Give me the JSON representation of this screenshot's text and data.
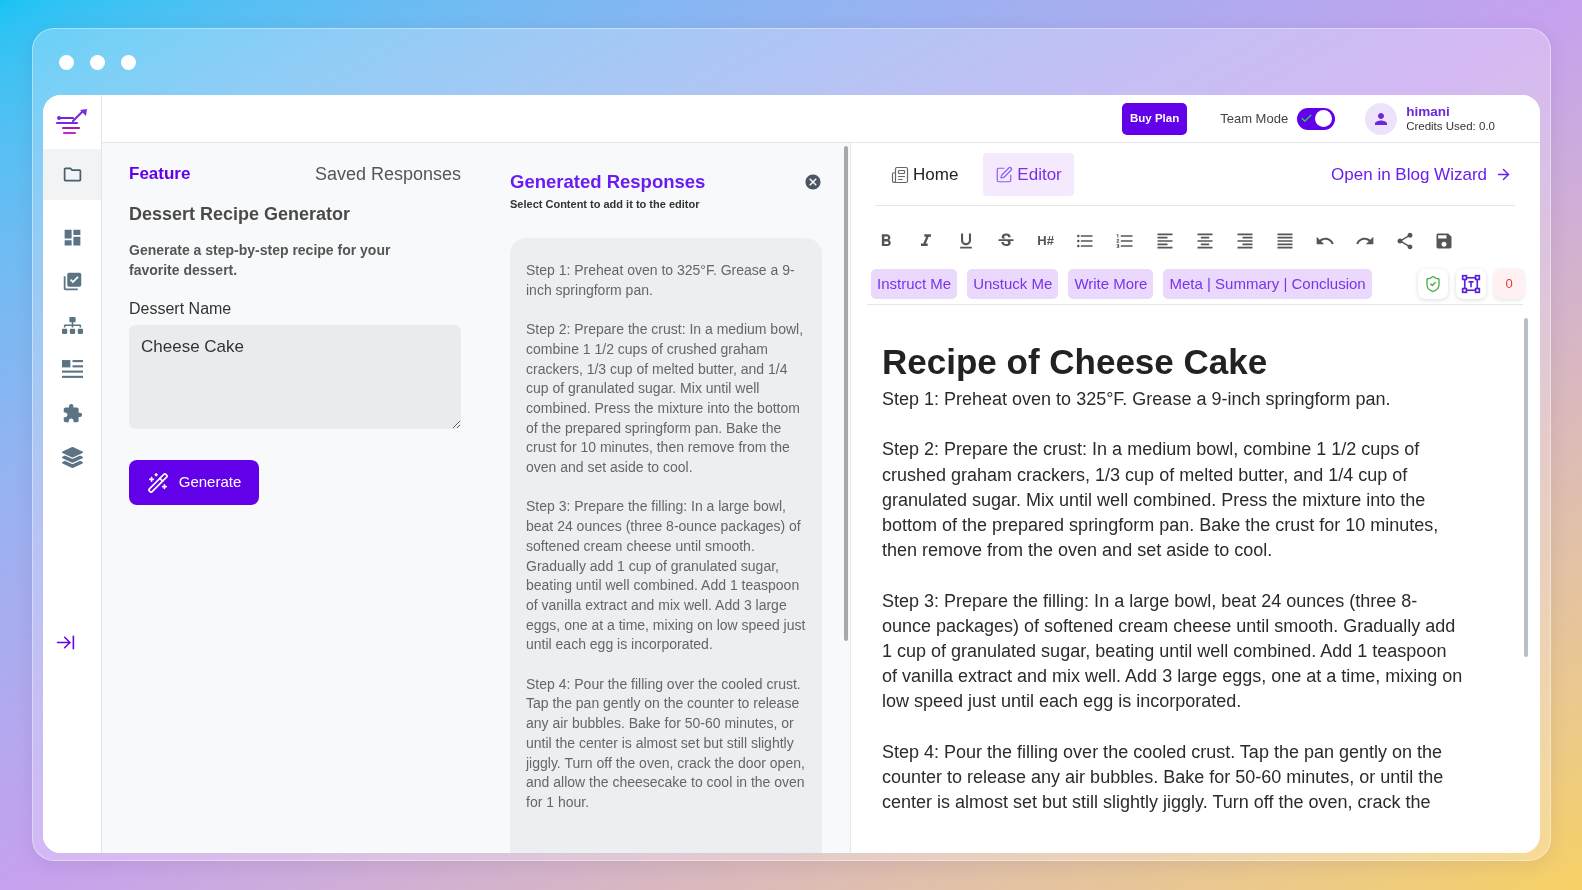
{
  "topbar": {
    "buy_plan": "Buy Plan",
    "team_mode": {
      "label": "Team Mode",
      "on": true
    },
    "user": {
      "name": "himani",
      "credits": "Credits Used: 0.0"
    }
  },
  "sidebar": {
    "items": [
      {
        "selected": true
      },
      {
        "selected": false
      },
      {
        "selected": false
      },
      {
        "selected": false
      },
      {
        "selected": false
      },
      {
        "selected": false
      },
      {
        "selected": false
      }
    ]
  },
  "feature_panel": {
    "tabs": [
      {
        "label": "Feature",
        "selected": true
      },
      {
        "label": "Saved Responses",
        "selected": false
      }
    ],
    "title": "Dessert Recipe Generator",
    "description": "Generate a step-by-step recipe for your favorite dessert.",
    "field": {
      "label": "Dessert Name",
      "value": "Cheese Cake"
    },
    "generate_button": "Generate"
  },
  "responses_panel": {
    "title": "Generated Responses",
    "subtitle": "Select Content to add it to the editor",
    "paragraphs": [
      "Step 1: Preheat oven to 325°F. Grease a 9-inch springform pan.",
      "Step 2: Prepare the crust: In a medium bowl, combine 1 1/2 cups of crushed graham crackers, 1/3 cup of melted butter, and 1/4 cup of granulated sugar. Mix until well combined. Press the mixture into the bottom of the prepared springform pan. Bake the crust for 10 minutes, then remove from the oven and set aside to cool.",
      "Step 3: Prepare the filling: In a large bowl, beat 24 ounces (three 8-ounce packages) of softened cream cheese until smooth. Gradually add 1 cup of granulated sugar, beating until well combined. Add 1 teaspoon of vanilla extract and mix well. Add 3 large eggs, one at a time, mixing on low speed just until each egg is incorporated.",
      "Step 4: Pour the filling over the cooled crust. Tap the pan gently on the counter to release any air bubbles. Bake for 50-60 minutes, or until the center is almost set but still slightly jiggly. Turn off the oven, crack the door open, and allow the cheesecake to cool in the oven for 1 hour."
    ]
  },
  "editor": {
    "tabs": [
      {
        "label": "Home",
        "selected": false
      },
      {
        "label": "Editor",
        "selected": true
      }
    ],
    "open_link": "Open in Blog Wizard",
    "heading_tool": "H#",
    "ai_buttons": [
      "Instruct Me",
      "Unstuck Me",
      "Write More",
      "Meta | Summary | Conclusion"
    ],
    "issue_count": "0",
    "heading": "Recipe of Cheese Cake",
    "paragraphs": [
      "Step 1: Preheat oven to 325°F. Grease a 9-inch springform pan.",
      "Step 2: Prepare the crust: In a medium bowl, combine 1 1/2 cups of crushed graham crackers, 1/3 cup of melted butter, and 1/4 cup of granulated sugar. Mix until well combined. Press the mixture into the bottom of the prepared springform pan. Bake the crust for 10 minutes, then remove from the oven and set aside to cool.",
      "Step 3: Prepare the filling: In a large bowl, beat 24 ounces (three 8-ounce packages) of softened cream cheese until smooth. Gradually add 1 cup of granulated sugar, beating until well combined. Add 1 teaspoon of vanilla extract and mix well. Add 3 large eggs, one at a time, mixing on low speed just until each egg is incorporated.",
      "Step 4: Pour the filling over the cooled crust. Tap the pan gently on the counter to release any air bubbles. Bake for 50-60 minutes, or until the center is almost set but still slightly jiggly. Turn off the oven, crack the"
    ]
  }
}
